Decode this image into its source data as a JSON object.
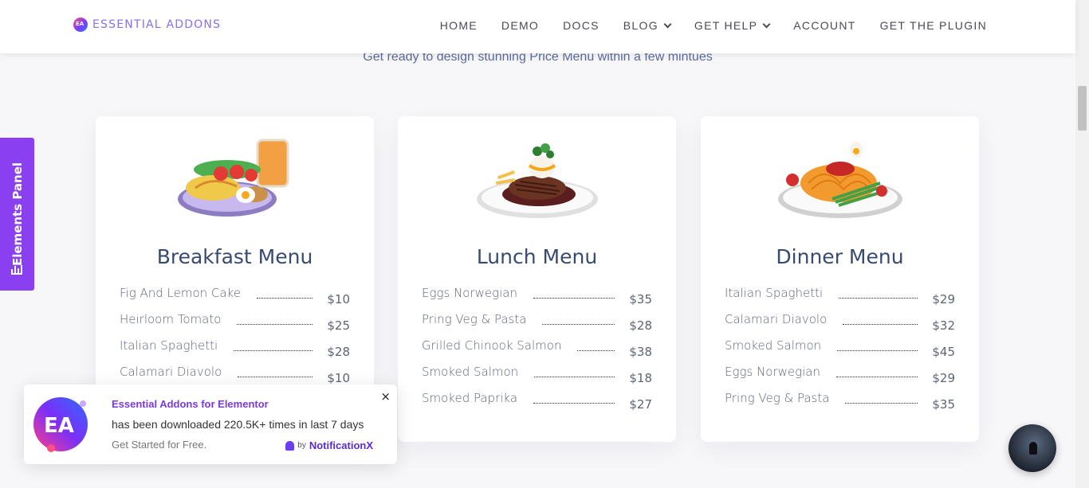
{
  "header": {
    "logo_text": "ESSENTIAL ADDONS",
    "nav": [
      {
        "label": "HOME",
        "dropdown": false
      },
      {
        "label": "DEMO",
        "dropdown": false
      },
      {
        "label": "DOCS",
        "dropdown": false
      },
      {
        "label": "BLOG",
        "dropdown": true
      },
      {
        "label": "GET HELP",
        "dropdown": true
      },
      {
        "label": "ACCOUNT",
        "dropdown": false
      },
      {
        "label": "GET THE PLUGIN",
        "dropdown": false
      }
    ]
  },
  "subtitle": "Get ready to design stunning Price Menu within a few mintues",
  "elements_panel": {
    "label": "Elements Panel",
    "icon": "bar-chart-icon"
  },
  "menus": [
    {
      "title": "Breakfast Menu",
      "image": "breakfast-plate-image",
      "items": [
        {
          "name": "Fig And Lemon Cake",
          "price": "$10"
        },
        {
          "name": "Heirloom Tomato",
          "price": "$25"
        },
        {
          "name": "Italian Spaghetti",
          "price": "$28"
        },
        {
          "name": "Calamari Diavolo",
          "price": "$10"
        }
      ]
    },
    {
      "title": "Lunch Menu",
      "image": "steak-plate-image",
      "items": [
        {
          "name": "Eggs Norwegian",
          "price": "$35"
        },
        {
          "name": "Pring Veg & Pasta",
          "price": "$28"
        },
        {
          "name": "Grilled Chinook Salmon",
          "price": "$38"
        },
        {
          "name": "Smoked Salmon",
          "price": "$18"
        },
        {
          "name": "Smoked Paprika",
          "price": "$27"
        }
      ]
    },
    {
      "title": "Dinner Menu",
      "image": "spaghetti-plate-image",
      "items": [
        {
          "name": "Italian Spaghetti",
          "price": "$29"
        },
        {
          "name": "Calamari Diavolo",
          "price": "$32"
        },
        {
          "name": "Smoked Salmon",
          "price": "$45"
        },
        {
          "name": "Eggs Norwegian",
          "price": "$29"
        },
        {
          "name": "Pring Veg & Pasta",
          "price": "$35"
        }
      ]
    }
  ],
  "notification": {
    "title": "Essential Addons for Elementor",
    "text": "has been downloaded 220.5K+ times in last 7 days",
    "cta": "Get Started for Free.",
    "by": "by",
    "brand": "NotificationX",
    "close": "×"
  },
  "colors": {
    "accent": "#8a3ff0",
    "title": "#374b70",
    "subtitle": "#5a6c9c"
  }
}
